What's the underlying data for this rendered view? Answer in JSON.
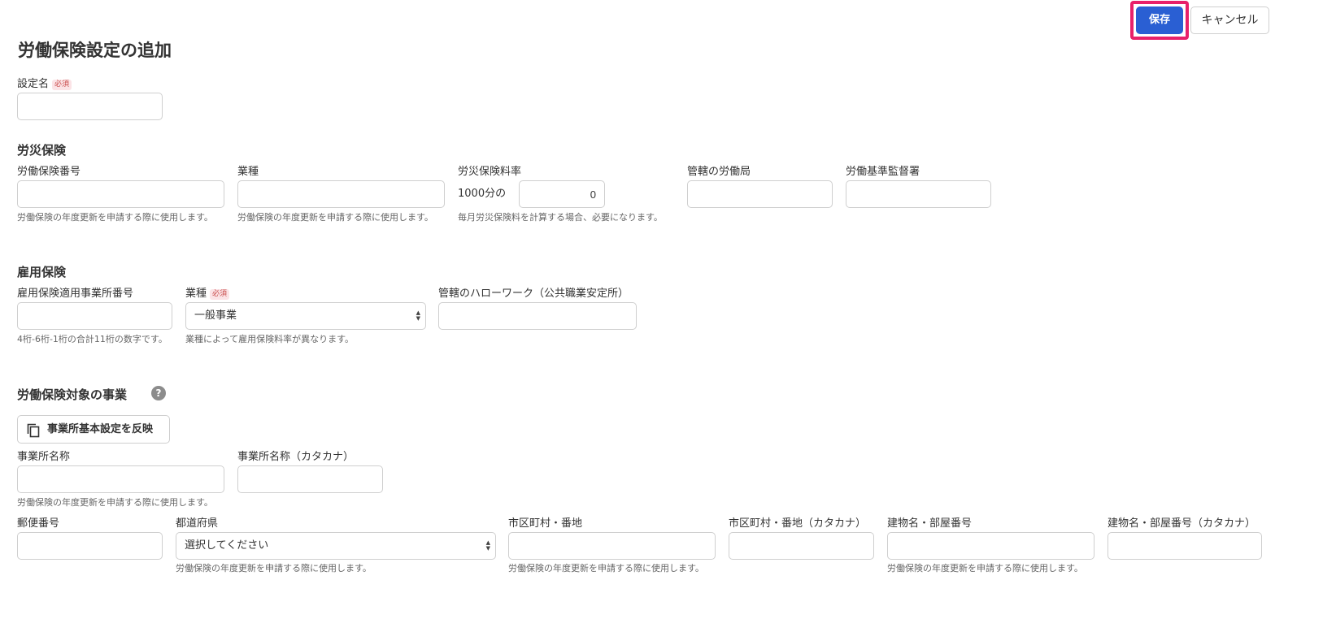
{
  "header": {
    "title": "労働保険設定の追加",
    "save_label": "保存",
    "cancel_label": "キャンセル"
  },
  "required_badge": "必須",
  "setting_name": {
    "label": "設定名",
    "value": ""
  },
  "rousai": {
    "section_title": "労災保険",
    "insurance_number": {
      "label": "労働保険番号",
      "value": "",
      "help": "労働保険の年度更新を申請する際に使用します。"
    },
    "industry": {
      "label": "業種",
      "value": "",
      "help": "労働保険の年度更新を申請する際に使用します。"
    },
    "rate": {
      "label": "労災保険料率",
      "prefix": "1000分の",
      "value": "0",
      "help": "毎月労災保険料を計算する場合、必要になります。"
    },
    "labor_bureau": {
      "label": "管轄の労働局",
      "value": ""
    },
    "inspection_office": {
      "label": "労働基準監督署",
      "value": ""
    }
  },
  "koyou": {
    "section_title": "雇用保険",
    "office_number": {
      "label": "雇用保険適用事業所番号",
      "value": "",
      "help": "4桁-6桁-1桁の合計11桁の数字です。"
    },
    "industry": {
      "label": "業種",
      "selected": "一般事業",
      "help": "業種によって雇用保険料率が異なります。"
    },
    "hello_work": {
      "label": "管轄のハローワーク（公共職業安定所）",
      "value": ""
    }
  },
  "business": {
    "section_title": "労働保険対象の事業",
    "help_icon": "?",
    "copy_button_label": "事業所基本設定を反映",
    "name": {
      "label": "事業所名称",
      "value": "",
      "help": "労働保険の年度更新を申請する際に使用します。"
    },
    "name_kana": {
      "label": "事業所名称（カタカナ）",
      "value": ""
    },
    "postal_code": {
      "label": "郵便番号",
      "value": ""
    },
    "prefecture": {
      "label": "都道府県",
      "selected": "選択してください",
      "help": "労働保険の年度更新を申請する際に使用します。"
    },
    "city": {
      "label": "市区町村・番地",
      "value": "",
      "help": "労働保険の年度更新を申請する際に使用します。"
    },
    "city_kana": {
      "label": "市区町村・番地（カタカナ）",
      "value": ""
    },
    "building": {
      "label": "建物名・部屋番号",
      "value": "",
      "help": "労働保険の年度更新を申請する際に使用します。"
    },
    "building_kana": {
      "label": "建物名・部屋番号（カタカナ）",
      "value": ""
    }
  },
  "colors": {
    "primary": "#2a5fd3",
    "highlight": "#e8206a",
    "required_bg": "#fbe3e6",
    "required_text": "#c94c4c"
  },
  "icons": {
    "copy": "copy-icon",
    "help": "question-circle-icon",
    "select_arrows": "chevron-up-down-icon"
  }
}
